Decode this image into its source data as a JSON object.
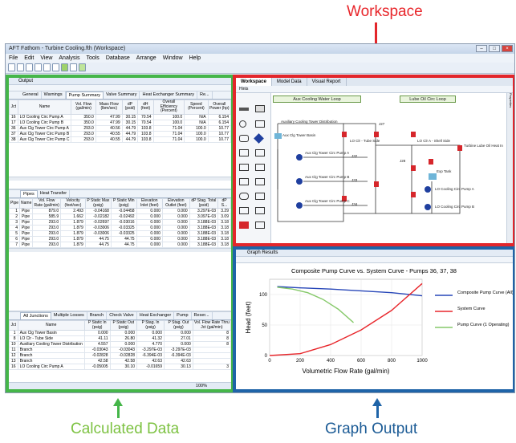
{
  "callouts": {
    "workspace": "Workspace",
    "calculated": "Calculated Data",
    "graph": "Graph Output"
  },
  "colors": {
    "workspace": "#e3262b",
    "calculated": "#45b649",
    "graph": "#1f64a8"
  },
  "app": {
    "title": "AFT Fathom - Turbine Cooling.fth (Workspace)",
    "menu": [
      "File",
      "Edit",
      "View",
      "Analysis",
      "Tools",
      "Database",
      "Arrange",
      "Window",
      "Help"
    ]
  },
  "output": {
    "title": "Output",
    "top_tabs": [
      "General",
      "Warnings",
      "Pump Summary",
      "Valve Summary",
      "Heat Exchanger Summary",
      "Re..."
    ],
    "pump_headers": [
      "Jct",
      "Name",
      "Vol. Flow (gal/min)",
      "Mass Flow (lbm/sec)",
      "dP (psid)",
      "dH (feet)",
      "Overall Efficiency (Percent)",
      "Speed (Percent)",
      "Overall Power (hp)"
    ],
    "pump_rows": [
      [
        "16",
        "LO Cooling Circ Pump A",
        "350.0",
        "47.99",
        "30.15",
        "70.54",
        "100.0",
        "N/A",
        "6.154"
      ],
      [
        "17",
        "LO Cooling Circ Pump B",
        "350.0",
        "47.99",
        "30.15",
        "70.54",
        "100.0",
        "N/A",
        "6.154"
      ],
      [
        "36",
        "Aux Clg Tower Circ Pump A",
        "293.0",
        "40.56",
        "44.79",
        "103.8",
        "71.04",
        "100.0",
        "10.77"
      ],
      [
        "37",
        "Aux Clg Tower Circ Pump B",
        "293.0",
        "40.55",
        "44.79",
        "103.8",
        "71.04",
        "100.0",
        "10.77"
      ],
      [
        "38",
        "Aux Clg Tower Circ Pump C",
        "293.0",
        "40.55",
        "44.79",
        "103.8",
        "71.04",
        "100.0",
        "10.77"
      ]
    ],
    "pipe_tabs": [
      "Pipes",
      "Heat Transfer"
    ],
    "pipe_headers": [
      "Pipe",
      "Name",
      "Vol. Flow Rate (gal/min)",
      "Velocity (feet/sec)",
      "P Static Max (psig)",
      "P Static Min (psig)",
      "Elevation Inlet (feet)",
      "Elevation Outlet (feet)",
      "dP Stag. Total (psid)",
      "dP S..."
    ],
    "pipe_rows": [
      [
        "1",
        "Pipe",
        "879.0",
        "2.493",
        "-0.04168",
        "-0.04458",
        "0.000",
        "0.000",
        "3.297E-03",
        "3.29"
      ],
      [
        "2",
        "Pipe",
        "585.9",
        "1.662",
        "-0.02182",
        "-0.02492",
        "0.000",
        "0.000",
        "3.097E-03",
        "3.09"
      ],
      [
        "3",
        "Pipe",
        "293.0",
        "1.879",
        "-0.02697",
        "-0.03016",
        "0.000",
        "0.000",
        "3.188E-03",
        "3.18"
      ],
      [
        "4",
        "Pipe",
        "293.0",
        "1.879",
        "-0.03006",
        "-0.03325",
        "0.000",
        "0.000",
        "3.188E-03",
        "3.18"
      ],
      [
        "5",
        "Pipe",
        "293.0",
        "1.879",
        "-0.03006",
        "-0.03325",
        "0.000",
        "0.000",
        "3.188E-03",
        "3.18"
      ],
      [
        "6",
        "Pipe",
        "293.0",
        "1.879",
        "44.75",
        "44.75",
        "0.000",
        "0.000",
        "3.188E-03",
        "3.18"
      ],
      [
        "7",
        "Pipe",
        "293.0",
        "1.879",
        "44.75",
        "44.75",
        "0.000",
        "0.000",
        "3.188E-03",
        "3.18"
      ]
    ],
    "jct_tabs": [
      "All Junctions",
      "Multiple Losses",
      "Branch",
      "Check Valve",
      "Heat Exchanger",
      "Pump",
      "Reser..."
    ],
    "jct_headers": [
      "Jct",
      "Name",
      "P Static In (psig)",
      "P Static Out (psig)",
      "P Stag. In (psig)",
      "P Stag. Out (psig)",
      "Vol. Flow Rate Thru Jct (gal/min)"
    ],
    "jct_rows": [
      [
        "1",
        "Aux Clg Tower Basin",
        "0.000",
        "0.000",
        "0.000",
        "0.000",
        "8"
      ],
      [
        "8",
        "LO Clr - Tube Side",
        "41.11",
        "26.80",
        "41.32",
        "27.01",
        "8"
      ],
      [
        "10",
        "Auxiliary Cooling Tower Distribution",
        "4.557",
        "0.000",
        "4.770",
        "0.000",
        "8"
      ],
      [
        "11",
        "Branch",
        "-0.03043",
        "-0.03043",
        "-3.297E-03",
        "-3.297E-03",
        ""
      ],
      [
        "12",
        "Branch",
        "-0.02828",
        "-0.02828",
        "-6.394E-03",
        "-6.394E-03",
        ""
      ],
      [
        "13",
        "Branch",
        "42.58",
        "42.58",
        "42.63",
        "42.63",
        ""
      ],
      [
        "16",
        "LO Cooling Circ Pump A",
        "-0.05005",
        "30.10",
        "-0.01659",
        "30.13",
        "3"
      ]
    ],
    "zoom": "100%"
  },
  "workspace": {
    "tabs": [
      "Workspace",
      "Model Data",
      "Visual Report"
    ],
    "hints": "Hints",
    "loops": [
      "Aux Cooling Water Loop",
      "Lube Oil Circ Loop"
    ],
    "labels": [
      "Auxiliary Cooling Tower Distribution",
      "Aux Clg Tower Basin",
      "J27",
      "LO Clr - Tube Side",
      "LO Clr A - Shell Side",
      "Turbine Lube Oil Heat In",
      "J28",
      "Exp Tank",
      "Aux Clg Tower Circ Pump A",
      "J32",
      "Aux Clg Tower Circ Pump B",
      "J33",
      "Aux Clg Tower Circ Pump C",
      "J34",
      "LO Cooling Circ Pump A",
      "LO Cooling Circ Pump B"
    ],
    "properties_tab": "Properties"
  },
  "graph": {
    "window_title": "Graph Results",
    "chart_data": {
      "type": "line",
      "title": "Composite Pump Curve vs. System Curve - Pumps 36, 37, 38",
      "xlabel": "Volumetric Flow Rate (gal/min)",
      "ylabel": "Head (feet)",
      "xlim": [
        0,
        1000
      ],
      "ylim": [
        0,
        125
      ],
      "xticks": [
        "0",
        "200",
        "400",
        "600",
        "800",
        "1000"
      ],
      "yticks": [
        "0",
        "50",
        "100"
      ],
      "grid": true,
      "legend_position": "right",
      "series": [
        {
          "name": "Composite Pump Curve (All)",
          "color": "#2746b8",
          "x": [
            50,
            200,
            400,
            600,
            800,
            1000
          ],
          "y": [
            113,
            111,
            109,
            106,
            103,
            98
          ]
        },
        {
          "name": "System Curve",
          "color": "#e8262b",
          "x": [
            0,
            200,
            400,
            600,
            800,
            1000
          ],
          "y": [
            0,
            3,
            18,
            42,
            74,
            118
          ]
        },
        {
          "name": "Pump Curve (1 Operating)",
          "color": "#86c96a",
          "x": [
            50,
            150,
            250,
            350,
            450,
            550
          ],
          "y": [
            112,
            109,
            103,
            92,
            76,
            54
          ]
        }
      ]
    }
  }
}
